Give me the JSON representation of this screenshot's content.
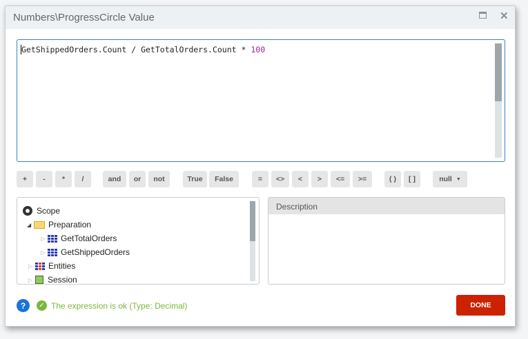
{
  "dialog": {
    "title": "Numbers\\ProgressCircle Value",
    "maximize_icon": "maximize-icon",
    "close_icon": "close-icon"
  },
  "editor": {
    "expression_text": "GetShippedOrders.Count / GetTotalOrders.Count * ",
    "expression_number": "100"
  },
  "operators": [
    {
      "label": "+"
    },
    {
      "label": "-"
    },
    {
      "label": "*"
    },
    {
      "label": "/"
    },
    {
      "label": "and"
    },
    {
      "label": "or"
    },
    {
      "label": "not"
    },
    {
      "label": "True"
    },
    {
      "label": "False"
    },
    {
      "label": "="
    },
    {
      "label": "<>"
    },
    {
      "label": "<"
    },
    {
      "label": ">"
    },
    {
      "label": "<="
    },
    {
      "label": ">="
    },
    {
      "label": "( )"
    },
    {
      "label": "[ ]"
    },
    {
      "label": "null"
    }
  ],
  "tree": {
    "items": [
      {
        "label": "Scope",
        "icon": "scope-icon"
      },
      {
        "label": "Preparation",
        "icon": "folder-icon"
      },
      {
        "label": "GetTotalOrders",
        "icon": "aggregate-icon"
      },
      {
        "label": "GetShippedOrders",
        "icon": "aggregate-icon"
      },
      {
        "label": "Entities",
        "icon": "entities-icon"
      },
      {
        "label": "Session",
        "icon": "session-icon"
      }
    ]
  },
  "description": {
    "header": "Description"
  },
  "footer": {
    "status": "The expression is ok (Type: Decimal)",
    "done_label": "DONE",
    "status_color": "#7ab83c",
    "done_color": "#cc2200"
  }
}
